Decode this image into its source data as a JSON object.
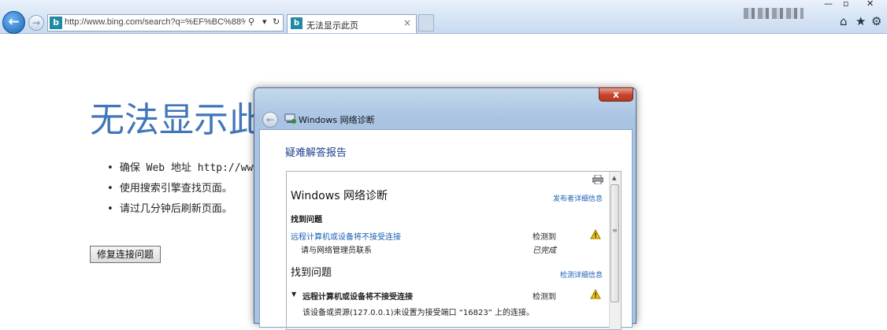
{
  "browser": {
    "url": "http://www.bing.com/search?q=%EF%BC%88%E4",
    "tab_title": "无法显示此页",
    "tab_close": "×",
    "back_glyph": "←",
    "forward_glyph": "→",
    "search_glyph": "⚲",
    "dropdown_glyph": "▾",
    "refresh_glyph": "↻",
    "site_icon_letter": "b",
    "window_controls": {
      "minimize": "—",
      "maximize": "▫",
      "close": "✕"
    },
    "tools": {
      "home": "⌂",
      "favorites": "★",
      "settings": "⚙"
    }
  },
  "error_page": {
    "title": "无法显示此页",
    "items": [
      "确保 Web 地址 http://www.",
      "使用搜索引擎查找页面。",
      "请过几分钟后刷新页面。"
    ],
    "fix_button": "修复连接问题"
  },
  "dialog": {
    "title": "Windows 网络诊断",
    "close_label": "x",
    "back_glyph": "←",
    "heading": "疑难解答报告",
    "report": {
      "title": "Windows 网络诊断",
      "publisher_link": "发布者详细信息",
      "found_problems_label": "找到问题",
      "problem_link": "远程计算机或设备将不接受连接",
      "problem_status": "检测到",
      "contact_text": "请与网络管理员联系",
      "contact_status": "已完成",
      "found_problems_heading": "找到问题",
      "detection_link": "检测详细信息",
      "detail_title": "远程计算机或设备将不接受连接",
      "detail_status": "检测到",
      "detail_text": "该设备或资源(127.0.0.1)未设置为接受端口 “16823” 上的连接。",
      "collapse_glyph": "▼"
    },
    "scroll_up_glyph": "▲",
    "scroll_grip_glyph": "≡"
  },
  "colors": {
    "error_title": "#4176b8",
    "link": "#1a5fb4",
    "dialog_heading": "#1a3e8c",
    "warning": "#f2c200"
  }
}
